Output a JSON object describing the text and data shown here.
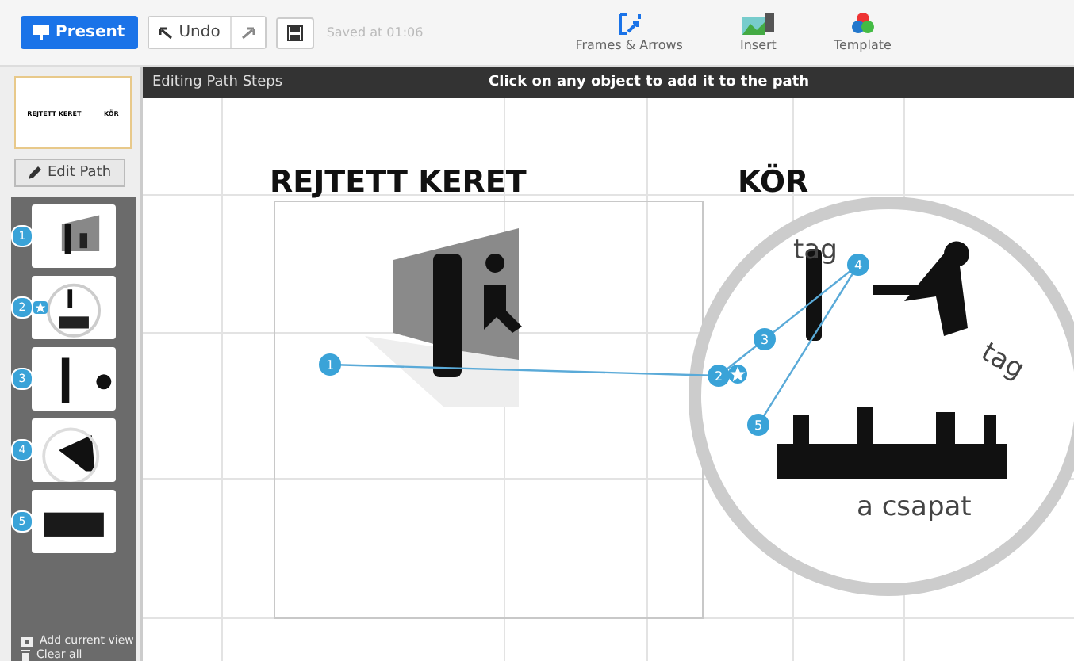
{
  "toolbar": {
    "present": "Present",
    "undo": "Undo",
    "saved": "Saved at 01:06",
    "tools": [
      {
        "kind": "frames",
        "label": "Frames & Arrows"
      },
      {
        "kind": "insert",
        "label": "Insert"
      },
      {
        "kind": "template",
        "label": "Template"
      }
    ]
  },
  "sidebar": {
    "overview_labels": [
      "REJTETT KERET",
      "KÖR"
    ],
    "edit_path": "Edit Path",
    "steps": [
      {
        "number": "1",
        "kind": "wall"
      },
      {
        "number": "2",
        "kind": "circle",
        "starred": true
      },
      {
        "number": "3",
        "kind": "singer"
      },
      {
        "number": "4",
        "kind": "guitar"
      },
      {
        "number": "5",
        "kind": "band"
      }
    ],
    "add_current_view": "Add current view",
    "clear_all": "Clear all"
  },
  "header": {
    "title": "Editing Path Steps",
    "hint": "Click on any object to add it to the path"
  },
  "canvas": {
    "frame_title": "REJTETT KERET",
    "circle_title": "KÖR",
    "circle_texts": [
      {
        "text": "tag",
        "kind": "upright"
      },
      {
        "text": "tag",
        "kind": "tilted"
      },
      {
        "text": "a csapat",
        "kind": "caption"
      }
    ],
    "markers": [
      {
        "number": "1",
        "starred": false
      },
      {
        "number": "2",
        "starred": true
      },
      {
        "number": "3",
        "starred": false
      },
      {
        "number": "4",
        "starred": false
      },
      {
        "number": "5",
        "starred": false
      }
    ]
  }
}
